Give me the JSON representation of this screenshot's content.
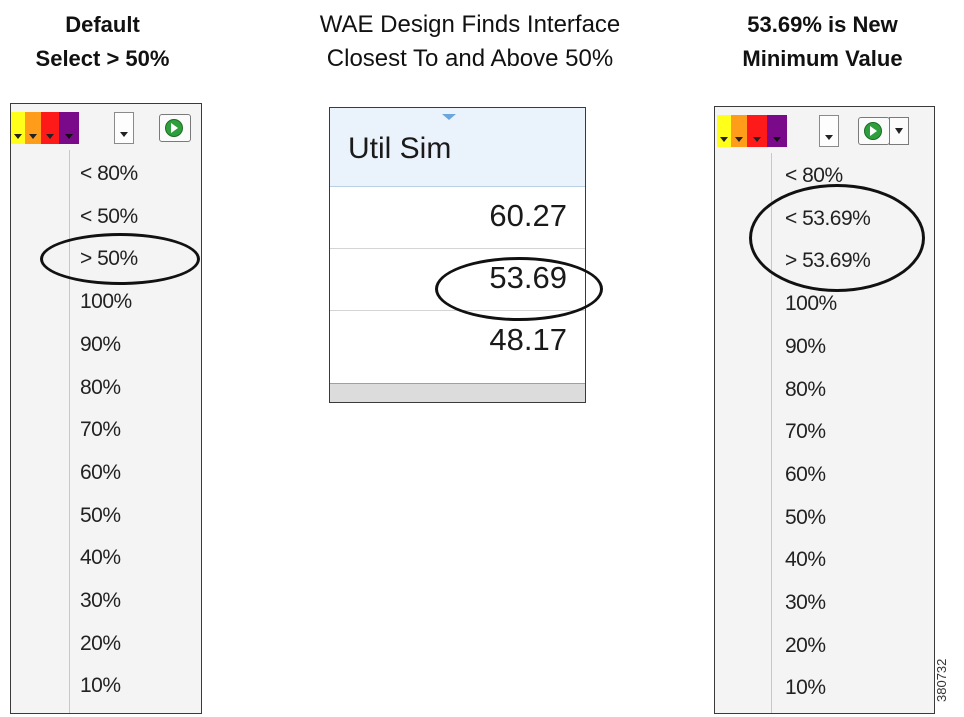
{
  "captions": {
    "left": [
      "Default",
      "Select > 50%"
    ],
    "middle": [
      "WAE Design Finds Interface",
      "Closest To and Above 50%"
    ],
    "right": [
      "53.69% is New",
      "Minimum Value"
    ]
  },
  "left_panel": {
    "swatch_colors": [
      "#ffff1a",
      "#ff9d1a",
      "#ff1a1a",
      "#7a0a8a"
    ],
    "items": [
      "< 80%",
      "< 50%",
      "> 50%",
      "100%",
      "90%",
      "80%",
      "70%",
      "60%",
      "50%",
      "40%",
      "30%",
      "20%",
      "10%"
    ],
    "highlighted": "> 50%"
  },
  "grid": {
    "header": "Util Sim",
    "rows": [
      "60.27",
      "53.69",
      "48.17"
    ],
    "highlighted": "53.69"
  },
  "right_panel": {
    "swatch_colors": [
      "#ffff1a",
      "#ff9d1a",
      "#ff1a1a",
      "#7a0a8a"
    ],
    "items": [
      "< 80%",
      "< 53.69%",
      "> 53.69%",
      "100%",
      "90%",
      "80%",
      "70%",
      "60%",
      "50%",
      "40%",
      "30%",
      "20%",
      "10%"
    ],
    "highlighted": [
      "< 53.69%",
      "> 53.69%"
    ]
  },
  "figure_id": "380732",
  "icons": [
    "play-icon",
    "dropdown-arrow-icon",
    "sort-indicator-icon"
  ]
}
